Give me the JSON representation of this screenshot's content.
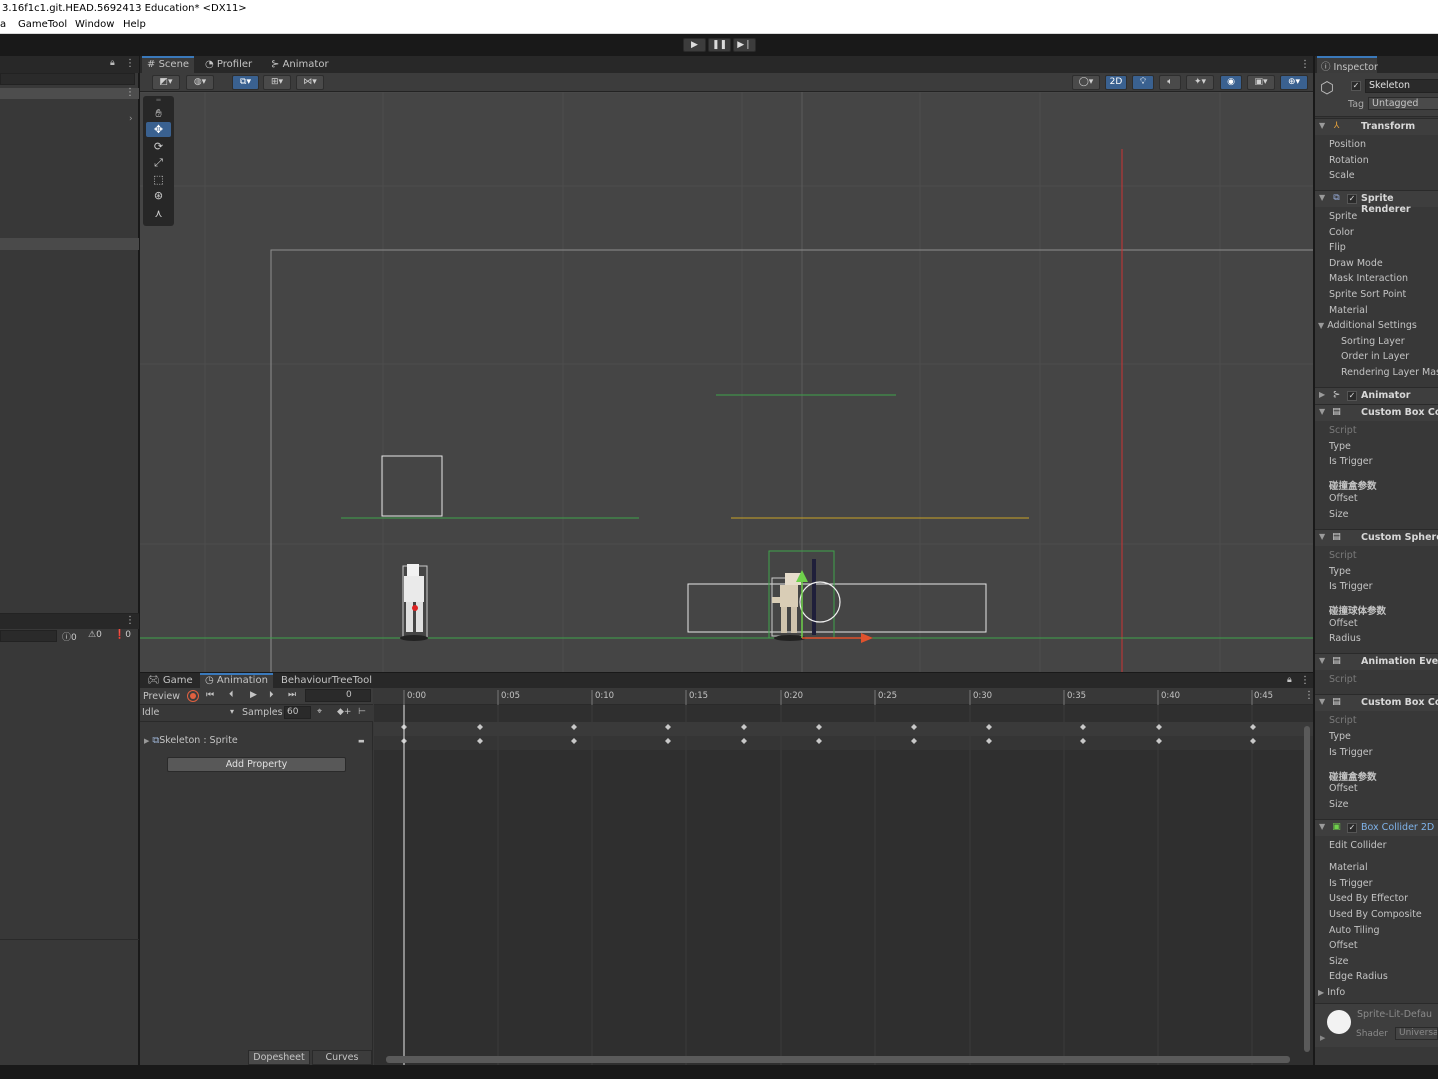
{
  "window": {
    "title": "3.16f1c1.git.HEAD.5692413 Education* <DX11>"
  },
  "menu": {
    "items": [
      "a",
      "GameTool",
      "Window",
      "Help"
    ]
  },
  "play_controls": {
    "play": "▶",
    "pause": "❚❚",
    "step": "▶❘"
  },
  "scene_tabs": [
    {
      "label": "Scene",
      "icon": "grid-icon"
    },
    {
      "label": "Profiler",
      "icon": "profiler-icon"
    },
    {
      "label": "Animator",
      "icon": "animator-icon"
    }
  ],
  "scene_toolbar": {
    "mode_2d": "2D"
  },
  "console_counts": {
    "messages": "0",
    "warnings": "0",
    "errors": "0"
  },
  "bottom_tabs": [
    {
      "label": "Game",
      "icon": "gamepad-icon"
    },
    {
      "label": "Animation",
      "icon": "animation-icon"
    },
    {
      "label": "BehaviourTreeTool",
      "icon": ""
    }
  ],
  "animation": {
    "preview_label": "Preview",
    "frame": "0",
    "clip": "Idle",
    "samples_label": "Samples",
    "samples": "60",
    "property": "Skeleton : Sprite",
    "add_property": "Add Property",
    "dopesheet": "Dopesheet",
    "curves": "Curves",
    "ruler": [
      "0:00",
      "0:05",
      "0:10",
      "0:15",
      "0:20",
      "0:25",
      "0:30",
      "0:35",
      "0:40",
      "0:45"
    ]
  },
  "inspector": {
    "tab": "Inspector",
    "object_name": "Skeleton",
    "tag_label": "Tag",
    "tag": "Untagged",
    "components": {
      "transform": {
        "title": "Transform",
        "fields": [
          "Position",
          "Rotation",
          "Scale"
        ]
      },
      "sprite_renderer": {
        "title": "Sprite Renderer",
        "fields": [
          "Sprite",
          "Color",
          "Flip",
          "Draw Mode",
          "Mask Interaction",
          "Sprite Sort Point",
          "Material"
        ],
        "additional": "Additional Settings",
        "additional_fields": [
          "Sorting Layer",
          "Order in Layer",
          "Rendering Layer Mask"
        ]
      },
      "animator": {
        "title": "Animator"
      },
      "custom_box_1": {
        "title": "Custom Box Colli",
        "fields": [
          "Script",
          "Type",
          "Is Trigger"
        ],
        "params": "碰撞盒参数",
        "param_fields": [
          "Offset",
          "Size"
        ]
      },
      "custom_sphere": {
        "title": "Custom Sphere C",
        "fields": [
          "Script",
          "Type",
          "Is Trigger"
        ],
        "params": "碰撞球体参数",
        "param_fields": [
          "Offset",
          "Radius"
        ]
      },
      "animation_event": {
        "title": "Animation Event",
        "fields": [
          "Script"
        ]
      },
      "custom_box_2": {
        "title": "Custom Box Colli",
        "fields": [
          "Script",
          "Type",
          "Is Trigger"
        ],
        "params": "碰撞盒参数",
        "param_fields": [
          "Offset",
          "Size"
        ]
      },
      "box_collider_2d": {
        "title": "Box Collider 2D",
        "fields": [
          "Edit Collider",
          "Material",
          "Is Trigger",
          "Used By Effector",
          "Used By Composite",
          "Auto Tiling",
          "Offset",
          "Size",
          "Edge Radius",
          "Info"
        ]
      },
      "material": {
        "name": "Sprite-Lit-Defau",
        "shader_label": "Shader",
        "shader": "Universa"
      }
    }
  }
}
